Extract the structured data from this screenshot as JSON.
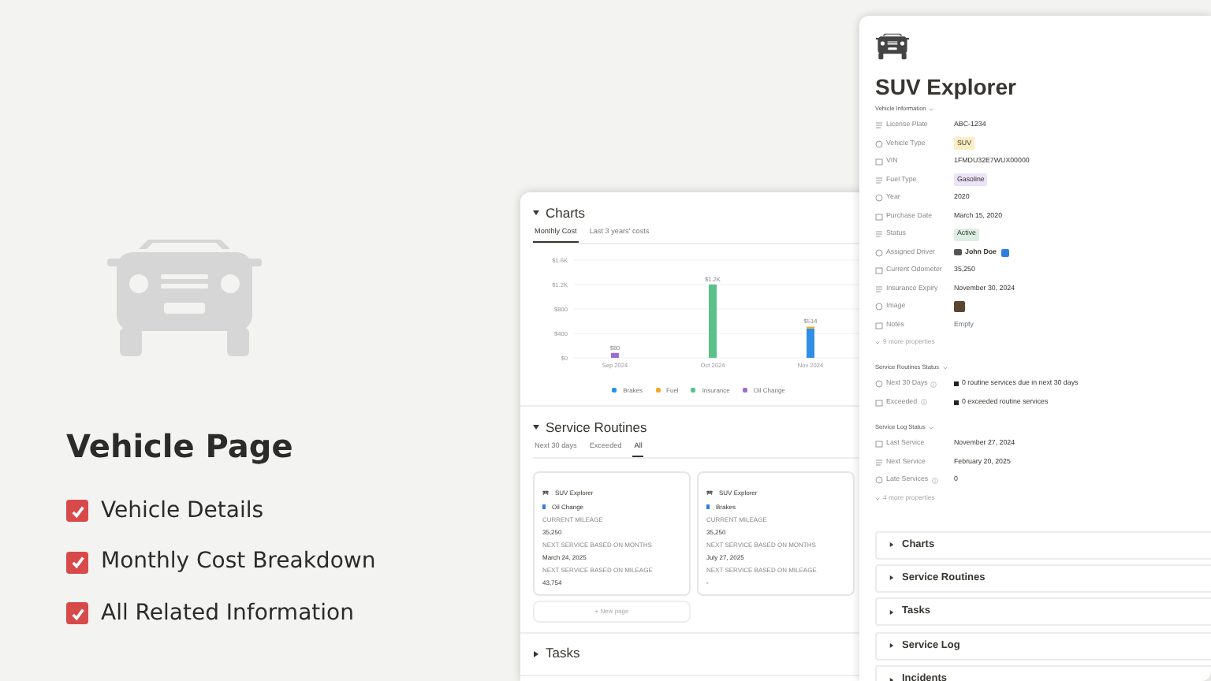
{
  "promo": {
    "title": "Vehicle Page",
    "features": [
      {
        "label": "Vehicle Details",
        "checked": true
      },
      {
        "label": "Monthly Cost Breakdown",
        "checked": true
      },
      {
        "label": "All Related Information",
        "checked": true
      }
    ]
  },
  "dashboard": {
    "charts": {
      "heading": "Charts",
      "expanded": true,
      "tabs": [
        {
          "label": "Monthly Cost",
          "selected": true
        },
        {
          "label": "Last 3 years' costs",
          "selected": false
        }
      ],
      "chart_data": {
        "type": "bar",
        "stacked": true,
        "categories": [
          "Sep 2024",
          "Oct 2024",
          "Nov 2024"
        ],
        "series": [
          {
            "name": "Brakes",
            "color": "#2f8fe6",
            "values": [
              0,
              0,
              480
            ]
          },
          {
            "name": "Fuel",
            "color": "#f0a82a",
            "values": [
              0,
              0,
              30
            ]
          },
          {
            "name": "Insurance",
            "color": "#5cc08a",
            "values": [
              0,
              1200,
              0
            ]
          },
          {
            "name": "Oil Change",
            "color": "#9b6bd6",
            "values": [
              80,
              0,
              0
            ]
          }
        ],
        "ylim": [
          0,
          1600
        ],
        "grid": true,
        "yticks": [
          {
            "value": 0,
            "label": "$0"
          },
          {
            "value": 400,
            "label": "$400"
          },
          {
            "value": 800,
            "label": "$800"
          },
          {
            "value": 1200,
            "label": "$1.2K"
          },
          {
            "value": 1600,
            "label": "$1.6K"
          }
        ],
        "value_labels": [
          "$80",
          "$1.2K",
          "$514"
        ]
      }
    },
    "routines": {
      "heading": "Service Routines",
      "expanded": true,
      "tabs": [
        {
          "label": "Next 30 days",
          "selected": false
        },
        {
          "label": "Exceeded",
          "selected": false
        },
        {
          "label": "All",
          "selected": true
        }
      ],
      "cards": [
        {
          "vehicle": "SUV Explorer",
          "service": "Oil Change",
          "fields": [
            {
              "label": "CURRENT MILEAGE",
              "value": "35,250"
            },
            {
              "label": "NEXT SERVICE BASED ON MONTHS",
              "value": "March 24, 2025"
            },
            {
              "label": "NEXT SERVICE BASED ON MILEAGE",
              "value": "43,754"
            }
          ]
        },
        {
          "vehicle": "SUV Explorer",
          "service": "Brakes",
          "fields": [
            {
              "label": "CURRENT MILEAGE",
              "value": "35,250"
            },
            {
              "label": "NEXT SERVICE BASED ON MONTHS",
              "value": "July 27, 2025"
            },
            {
              "label": "NEXT SERVICE BASED ON MILEAGE",
              "value": "-"
            }
          ]
        }
      ],
      "new_page": "+ New page"
    },
    "tasks": {
      "heading": "Tasks",
      "expanded": false
    }
  },
  "vehicle_page": {
    "title": "SUV Explorer",
    "groups": [
      {
        "heading": "Vehicle Information",
        "properties": [
          {
            "label": "License Plate",
            "kind": "text",
            "value": "ABC-1234"
          },
          {
            "label": "Vehicle Type",
            "kind": "tag",
            "value": "SUV",
            "color": "#fbeec4"
          },
          {
            "label": "VIN",
            "kind": "text",
            "value": "1FMDU32E7WUX00000"
          },
          {
            "label": "Fuel Type",
            "kind": "tag",
            "value": "Gasoline",
            "color": "#ece3f7"
          },
          {
            "label": "Year",
            "kind": "text",
            "value": "2020"
          },
          {
            "label": "Purchase Date",
            "kind": "text",
            "value": "March 15, 2020"
          },
          {
            "label": "Status",
            "kind": "tag",
            "value": "Active",
            "color": "#ddefe3"
          },
          {
            "label": "Assigned Driver",
            "kind": "person",
            "value": "John Doe"
          },
          {
            "label": "Current Odometer",
            "kind": "text",
            "value": "35,250"
          },
          {
            "label": "Insurance Expiry",
            "kind": "text",
            "value": "November 30, 2024"
          },
          {
            "label": "Image",
            "kind": "image"
          },
          {
            "label": "Notes",
            "kind": "empty",
            "value": "Empty"
          }
        ],
        "more": "9 more properties"
      },
      {
        "heading": "Service Routines Status",
        "properties": [
          {
            "label": "Next 30 Days",
            "kind": "status",
            "info": true,
            "value": "0 routine services due in next 30 days"
          },
          {
            "label": "Exceeded",
            "kind": "status",
            "info": true,
            "value": "0 exceeded routine services"
          }
        ]
      },
      {
        "heading": "Service Log Status",
        "properties": [
          {
            "label": "Last Service",
            "kind": "text",
            "value": "November 27, 2024"
          },
          {
            "label": "Next Service",
            "kind": "text",
            "value": "February 20, 2025"
          },
          {
            "label": "Late Services",
            "kind": "text",
            "info": true,
            "value": "0"
          }
        ],
        "more": "4 more properties"
      }
    ],
    "toggles": [
      {
        "label": "Charts",
        "expanded": false
      },
      {
        "label": "Service Routines",
        "expanded": false
      },
      {
        "label": "Tasks",
        "expanded": false
      },
      {
        "label": "Service Log",
        "expanded": false
      },
      {
        "label": "Incidents",
        "expanded": false
      }
    ]
  }
}
